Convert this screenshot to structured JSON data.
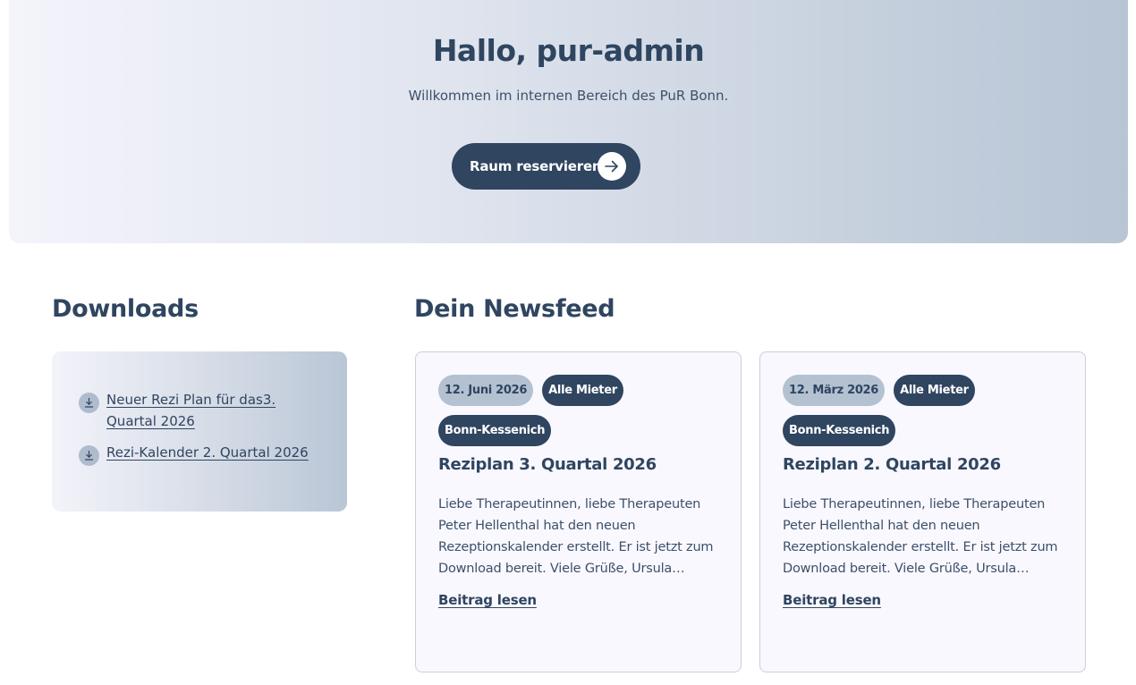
{
  "hero": {
    "title": "Hallo, pur-admin",
    "subtitle": "Willkommen im internen Bereich des PuR Bonn.",
    "button_label": "Raum reservieren"
  },
  "downloads": {
    "title": "Downloads",
    "items": [
      {
        "label": "Neuer Rezi Plan für das3. Quartal 2026"
      },
      {
        "label": "Rezi-Kalender 2. Quartal 2026"
      }
    ]
  },
  "newsfeed": {
    "title": "Dein Newsfeed",
    "posts": [
      {
        "date": "12. Juni 2026",
        "tags": [
          "Alle Mieter",
          "Bonn-Kessenich"
        ],
        "title": "Reziplan 3. Quartal 2026",
        "excerpt": "Liebe Therapeutinnen, liebe Therapeuten Peter Hellenthal hat den neuen Rezeptionskalender erstellt. Er ist jetzt zum Download bereit. Viele Grüße, Ursula…",
        "link_label": "Beitrag lesen"
      },
      {
        "date": "12. März 2026",
        "tags": [
          "Alle Mieter",
          "Bonn-Kessenich"
        ],
        "title": "Reziplan 2. Quartal 2026",
        "excerpt": "Liebe Therapeutinnen, liebe Therapeuten Peter Hellenthal hat den neuen Rezeptionskalender erstellt. Er ist jetzt zum Download bereit. Viele Grüße, Ursula…",
        "link_label": "Beitrag lesen"
      }
    ]
  },
  "colors": {
    "primary": "#2f4560",
    "tag_light": "#b3c1d1",
    "card_bg": "#f9f8ff"
  },
  "icons": {
    "button": "arrow-right-icon",
    "download": "download-icon"
  }
}
